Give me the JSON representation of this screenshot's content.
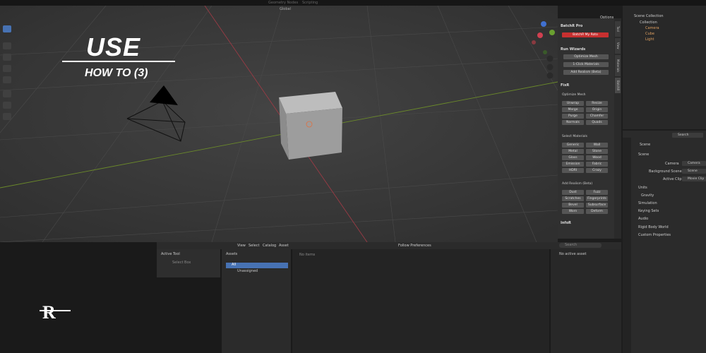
{
  "overlay": {
    "title": "USE",
    "subtitle": "HOW TO (3)",
    "logo": "R"
  },
  "topbar": {
    "tabs": [
      "Geometry Nodes",
      "Scripting"
    ]
  },
  "viewport": {
    "orientation": "Global",
    "options_label": "Options"
  },
  "npanel": {
    "addon_title": "BatchR Pro",
    "main_button": "BatchR My Roto",
    "run_wizards": "Run Wizards",
    "wizard_buttons": [
      "Optimize Mesh",
      "1-Click Materials",
      "Add Realism (Beta)"
    ],
    "fixr": "FixR",
    "optimize_mesh": "Optimize Mesh",
    "mesh_buttons": [
      "Unwrap",
      "Resize",
      "Merge",
      "Origin",
      "Purge",
      "Chamfer",
      "Normals",
      "Quads"
    ],
    "select_materials": "Select Materials",
    "material_buttons": [
      "Generic",
      "Wall",
      "Metal",
      "Stone",
      "Glass",
      "Wood",
      "Emission",
      "Fabric",
      "HDRI",
      "Crazy"
    ],
    "add_realism": "Add Realism (Beta)",
    "realism_buttons": [
      "Dust",
      "Fuzz",
      "Scratches",
      "Fingerprints",
      "Bevel",
      "Subsurface",
      "Worn",
      "Deform"
    ],
    "infor": "InfoR"
  },
  "vtabs": [
    "Tool",
    "View",
    "Materials",
    "BatchR"
  ],
  "outliner": {
    "title": "Scene Collection",
    "collection": "Collection",
    "items": [
      "Camera",
      "Cube",
      "Light"
    ]
  },
  "props": {
    "search_placeholder": "Search",
    "context": "Scene",
    "section": "Scene",
    "rows": [
      {
        "label": "Camera",
        "value": "Camera"
      },
      {
        "label": "Background Scene",
        "value": "Scene"
      },
      {
        "label": "Active Clip",
        "value": "Movie Clip"
      }
    ],
    "panels": [
      "Units",
      "Gravity",
      "Simulation",
      "Keying Sets",
      "Audio",
      "Rigid Body World",
      "Custom Properties"
    ]
  },
  "asset_browser": {
    "menus": [
      "View",
      "Select",
      "Catalog",
      "Asset"
    ],
    "library": "Follow Preferences",
    "search_placeholder": "Search",
    "assets_label": "Assets",
    "catalogs": [
      "All",
      "Unassigned"
    ],
    "no_items": "No items",
    "no_active": "No active asset"
  },
  "active_tool": {
    "title": "Active Tool",
    "tool": "Select Box"
  },
  "colors": {
    "accent": "#4772b3",
    "addon_red": "#c73030"
  }
}
